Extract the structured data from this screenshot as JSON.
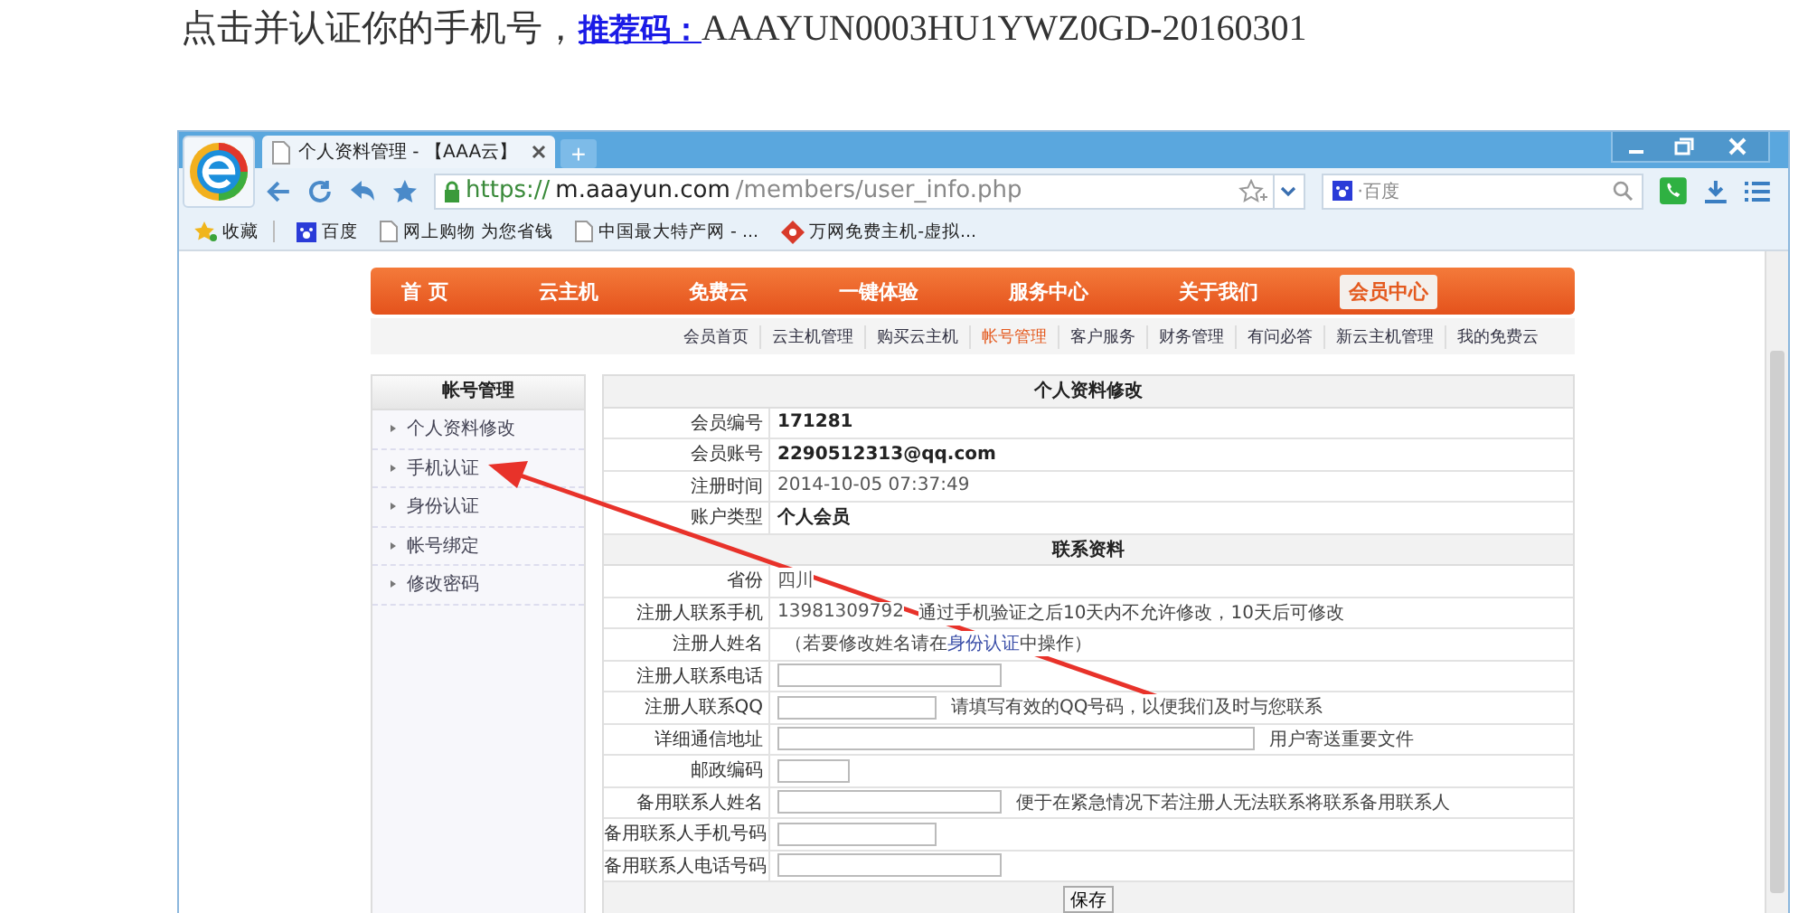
{
  "instruction": {
    "text": "点击并认证你的手机号，",
    "link": "推荐码：",
    "code": "AAAYUN0003HU1YWZ0GD-20160301"
  },
  "browser": {
    "tab_title": "个人资料管理 - 【AAA云】",
    "new_tab": "+",
    "url": {
      "scheme": "https://",
      "host": "m.aaayun.com",
      "path": "/members/user_info.php"
    },
    "search_placeholder": "·百度",
    "bookmarks": [
      {
        "kind": "favorites",
        "label": "收藏"
      },
      {
        "kind": "baidu",
        "label": "百度"
      },
      {
        "kind": "page",
        "label": "网上购物 为您省钱"
      },
      {
        "kind": "page",
        "label": "中国最大特产网 - ..."
      },
      {
        "kind": "diamond",
        "label": "万网免费主机-虚拟..."
      }
    ]
  },
  "nav": [
    {
      "label": "首 页",
      "selected": false
    },
    {
      "label": "云主机",
      "selected": false
    },
    {
      "label": "免费云",
      "selected": false
    },
    {
      "label": "一键体验",
      "selected": false
    },
    {
      "label": "服务中心",
      "selected": false
    },
    {
      "label": "关于我们",
      "selected": false
    },
    {
      "label": "会员中心",
      "selected": true
    }
  ],
  "subnav": [
    {
      "label": "会员首页",
      "selected": false
    },
    {
      "label": "云主机管理",
      "selected": false
    },
    {
      "label": "购买云主机",
      "selected": false
    },
    {
      "label": "帐号管理",
      "selected": true
    },
    {
      "label": "客户服务",
      "selected": false
    },
    {
      "label": "财务管理",
      "selected": false
    },
    {
      "label": "有问必答",
      "selected": false
    },
    {
      "label": "新云主机管理",
      "selected": false
    },
    {
      "label": "我的免费云",
      "selected": false
    }
  ],
  "sidebar": {
    "title": "帐号管理",
    "items": [
      "个人资料修改",
      "手机认证",
      "身份认证",
      "帐号绑定",
      "修改密码"
    ]
  },
  "form": {
    "rows": [
      {
        "kind": "header",
        "label": "个人资料修改"
      },
      {
        "kind": "text",
        "label": "会员编号",
        "value": "171281",
        "bold": true
      },
      {
        "kind": "text",
        "label": "会员账号",
        "value": "2290512313@qq.com",
        "bold": true
      },
      {
        "kind": "text",
        "label": "注册时间",
        "value": "2014-10-05 07:37:49",
        "bold": false
      },
      {
        "kind": "text",
        "label": "账户类型",
        "value": "个人会员",
        "bold": true
      },
      {
        "kind": "header",
        "label": "联系资料"
      },
      {
        "kind": "text",
        "label": "省份",
        "value": "四川",
        "bold": false
      },
      {
        "kind": "text",
        "label": "注册人联系手机",
        "value": "13981309792",
        "bold": false,
        "note": "通过手机验证之后10天内不允许修改，10天后可修改"
      },
      {
        "kind": "link_note",
        "label": "注册人姓名",
        "before": "（若要修改姓名请在",
        "link": "身份认证",
        "after": "中操作）"
      },
      {
        "kind": "input",
        "label": "注册人联系电话"
      },
      {
        "kind": "input",
        "label": "注册人联系QQ",
        "note": "请填写有效的QQ号码，以便我们及时与您联系"
      },
      {
        "kind": "input",
        "label": "详细通信地址",
        "note": "用户寄送重要文件"
      },
      {
        "kind": "input",
        "label": "邮政编码"
      },
      {
        "kind": "input",
        "label": "备用联系人姓名",
        "note": "便于在紧急情况下若注册人无法联系将联系备用联系人"
      },
      {
        "kind": "input",
        "label": "备用联系人手机号码"
      },
      {
        "kind": "input",
        "label": "备用联系人电话号码"
      }
    ],
    "save": "保存"
  }
}
